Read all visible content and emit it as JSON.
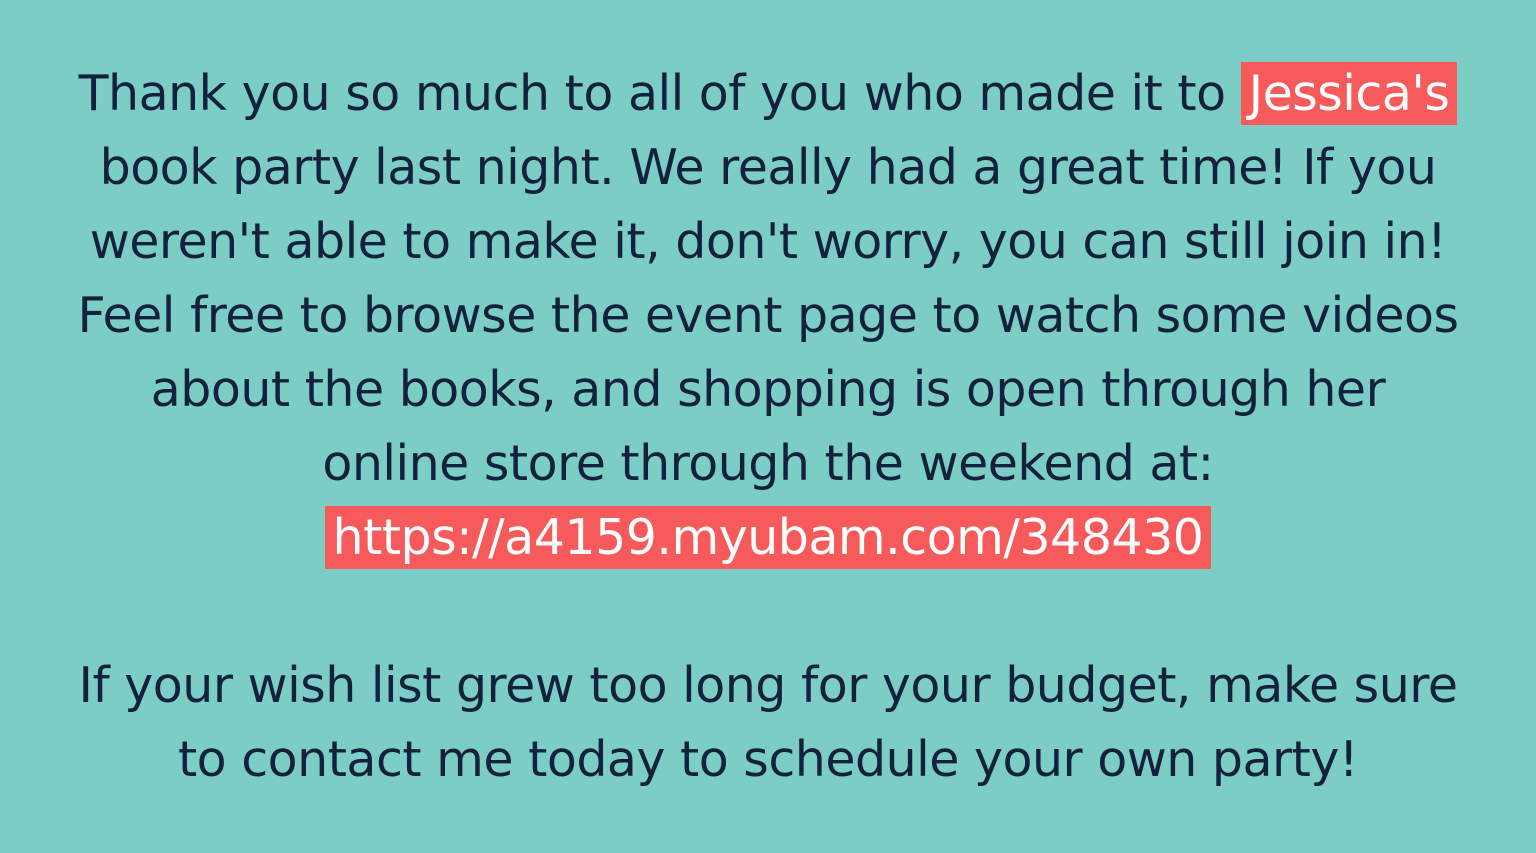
{
  "paragraph1": {
    "line1_text": "Thank you so much to all of you who made it to ",
    "line1_highlight": "Jessica's",
    "line2": "book party last night. We really had a great time! If you",
    "line3": "weren't able to make it, don't worry, you can still join in!",
    "line4": "Feel free to browse the event page to watch some videos",
    "line5": "about the books, and shopping is open through her",
    "line6": "online store through the weekend at:",
    "link": "https://a4159.myubam.com/348430"
  },
  "paragraph2": {
    "line1": "If your wish list grew too long for your budget, make sure",
    "line2": "to contact me today to schedule your own party!"
  },
  "colors": {
    "background": "#7ccdc5",
    "text": "#14213d",
    "highlight": "#f75a5b",
    "highlight_text": "#ffffff"
  }
}
